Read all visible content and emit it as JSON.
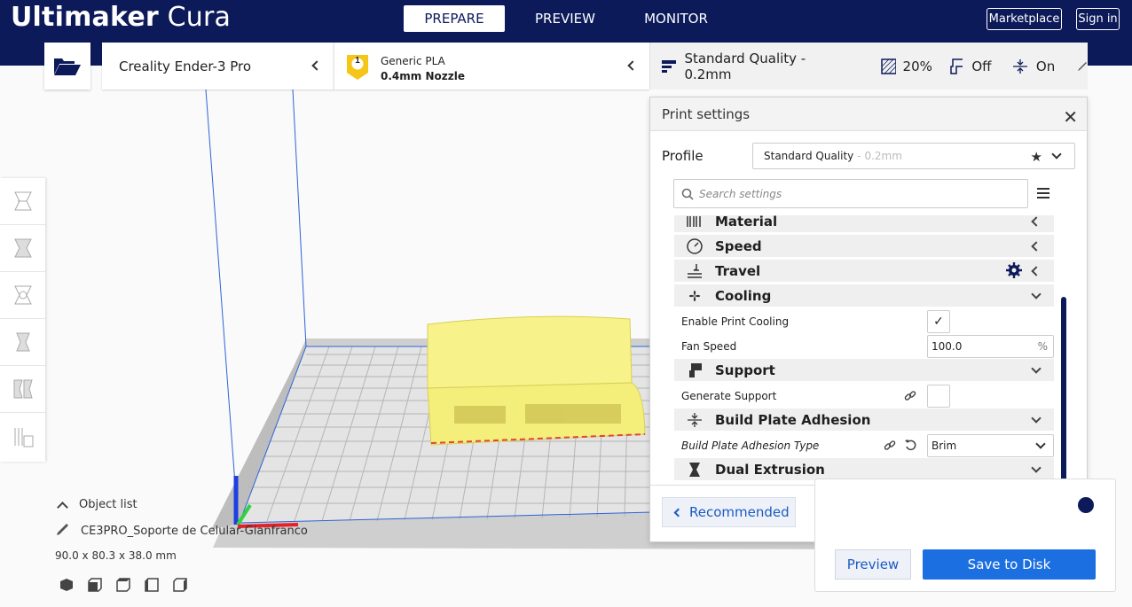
{
  "app": {
    "brand_bold": "Ultimaker",
    "brand_light": " Cura"
  },
  "header": {
    "tabs": [
      {
        "label": "PREPARE",
        "active": true
      },
      {
        "label": "PREVIEW",
        "active": false
      },
      {
        "label": "MONITOR",
        "active": false
      }
    ],
    "marketplace": "Marketplace",
    "signin": "Sign in"
  },
  "toolbar": {
    "printer": "Creality Ender-3 Pro",
    "extruder_number": "1",
    "material": "Generic PLA",
    "nozzle": "0.4mm Nozzle",
    "quality": "Standard Quality - 0.2mm",
    "infill": "20%",
    "support": "Off",
    "adhesion": "On"
  },
  "print_settings": {
    "title": "Print settings",
    "profile_label": "Profile",
    "profile_value": "Standard Quality",
    "profile_suffix": " - 0.2mm",
    "search_placeholder": "Search settings",
    "categories": {
      "material": "Material",
      "speed": "Speed",
      "travel": "Travel",
      "cooling": "Cooling",
      "support": "Support",
      "adhesion": "Build Plate Adhesion",
      "dual": "Dual Extrusion"
    },
    "settings": {
      "enable_cooling_label": "Enable Print Cooling",
      "enable_cooling_checked": true,
      "fan_speed_label": "Fan Speed",
      "fan_speed_value": "100.0",
      "fan_speed_unit": "%",
      "generate_support_label": "Generate Support",
      "generate_support_checked": false,
      "adhesion_type_label": "Build Plate Adhesion Type",
      "adhesion_type_value": "Brim"
    },
    "recommended": "Recommended",
    "more_dots": "• • •"
  },
  "object": {
    "list_label": "Object list",
    "name": "CE3PRO_Soporte de Celular-Gianfranco",
    "dimensions": "90.0 x 80.3 x 38.0 mm"
  },
  "actions": {
    "preview": "Preview",
    "save": "Save to Disk"
  },
  "colors": {
    "header_bg": "#0d1a5a",
    "accent_blue": "#1c6fe0",
    "model_yellow": "#f7f28a"
  }
}
